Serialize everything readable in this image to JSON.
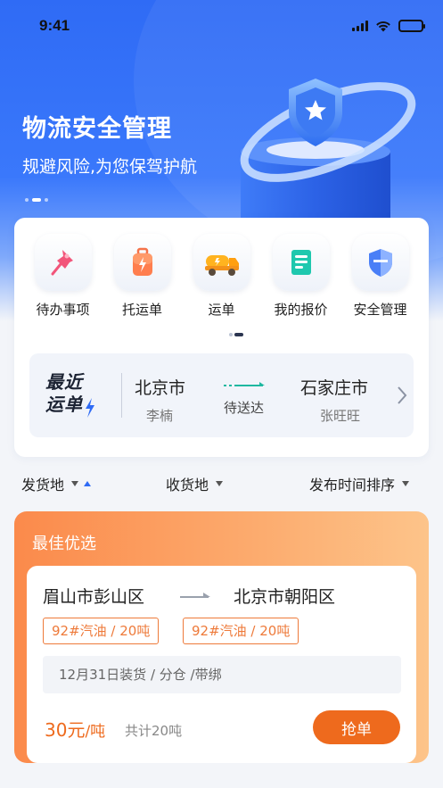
{
  "status_bar": {
    "time": "9:41"
  },
  "hero": {
    "title": "物流安全管理",
    "subtitle": "规避风险,为您保驾护航"
  },
  "menu": {
    "items": [
      {
        "label": "待办事项",
        "icon": "pushpin-icon"
      },
      {
        "label": "托运单",
        "icon": "luggage-icon"
      },
      {
        "label": "运单",
        "icon": "tanker-truck-icon"
      },
      {
        "label": "我的报价",
        "icon": "document-icon"
      },
      {
        "label": "安全管理",
        "icon": "shield-icon"
      }
    ]
  },
  "recent": {
    "badge_line1": "最近",
    "badge_line2": "运单",
    "from_city": "北京市",
    "from_person": "李楠",
    "status": "待送达",
    "to_city": "石家庄市",
    "to_person": "张旺旺"
  },
  "filters": {
    "ship_from": "发货地",
    "ship_to": "收货地",
    "sort": "发布时间排序"
  },
  "best": {
    "title": "最佳优选",
    "order": {
      "from": "眉山市彭山区",
      "to": "北京市朝阳区",
      "tags": [
        "92#汽油 / 20吨",
        "92#汽油 / 20吨"
      ],
      "info": "12月31日装货  / 分仓 /带绑",
      "price": "30元",
      "price_unit": "/吨",
      "total": "共计20吨",
      "action": "抢单"
    }
  },
  "colors": {
    "primary_blue": "#2f6bf5",
    "accent_orange": "#ee6a1d",
    "best_gradient_start": "#fb8a4b",
    "best_gradient_end": "#fdc48a"
  }
}
